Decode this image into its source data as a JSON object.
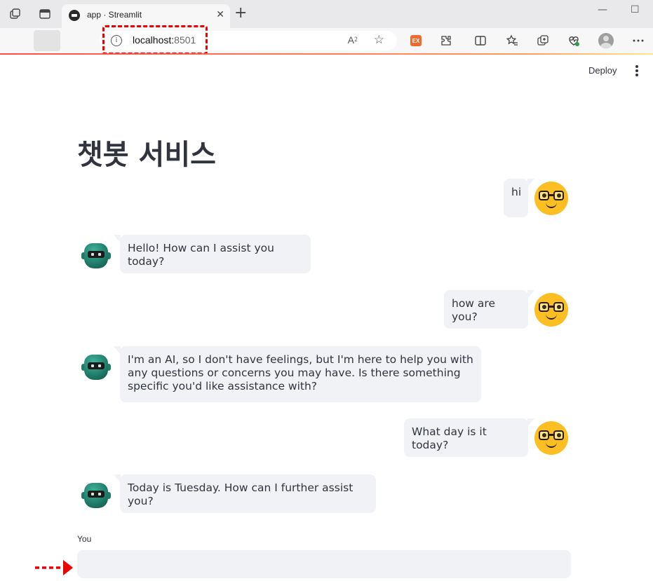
{
  "browser": {
    "tab_title": "app · Streamlit",
    "tab_close_glyph": "✕",
    "new_tab_glyph": "+",
    "url_host": "localhost:",
    "url_port": "8501",
    "read_aloud_glyph": "A⁲",
    "icons": [
      "tab-actions-icon",
      "vertical-tabs-icon",
      "back-icon",
      "reload-icon",
      "home-icon",
      "info-icon",
      "read-aloud-icon",
      "favorite-star-icon",
      "extension-ex-icon",
      "extensions-icon",
      "split-screen-icon",
      "favorites-icon",
      "collections-icon",
      "browser-essentials-icon",
      "profile-icon",
      "more-icon",
      "minimize-icon",
      "maximize-icon"
    ],
    "ext_label": "EX"
  },
  "app": {
    "deploy_label": "Deploy",
    "title": "챗봇 서비스",
    "messages": [
      {
        "role": "user",
        "text": "hi"
      },
      {
        "role": "assistant",
        "text": "Hello! How can I assist you today?"
      },
      {
        "role": "user",
        "text": "how are you?"
      },
      {
        "role": "assistant",
        "text": "I'm an AI, so I don't have feelings, but I'm here to help you with any questions or concerns you may have. Is there something specific you'd like assistance with?"
      },
      {
        "role": "user",
        "text": "What day is it today?"
      },
      {
        "role": "assistant",
        "text": "Today is Tuesday. How can I further assist you?"
      }
    ],
    "input_label": "You",
    "input_value": ""
  },
  "colors": {
    "accent": "#ff4b4b",
    "bubble_bg": "#f0f2f6",
    "annotation": "#ee0000",
    "user_avatar": "#fbbf24",
    "bot_avatar": "#1f7a68"
  }
}
